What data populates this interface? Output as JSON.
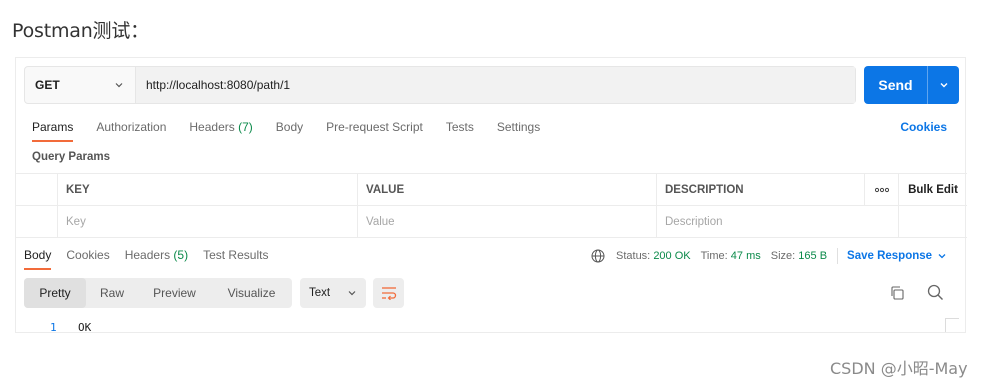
{
  "heading": "Postman测试：",
  "request": {
    "method": "GET",
    "url": "http://localhost:8080/path/1",
    "send_label": "Send"
  },
  "request_tabs": [
    {
      "label": "Params",
      "count": ""
    },
    {
      "label": "Authorization",
      "count": ""
    },
    {
      "label": "Headers",
      "count": "(7)"
    },
    {
      "label": "Body",
      "count": ""
    },
    {
      "label": "Pre-request Script",
      "count": ""
    },
    {
      "label": "Tests",
      "count": ""
    },
    {
      "label": "Settings",
      "count": ""
    }
  ],
  "cookies_link": "Cookies",
  "query_params": {
    "title": "Query Params",
    "columns": [
      "KEY",
      "VALUE",
      "DESCRIPTION"
    ],
    "more_label": "ooo",
    "bulk_edit": "Bulk Edit",
    "placeholders": [
      "Key",
      "Value",
      "Description"
    ]
  },
  "response_tabs": [
    {
      "label": "Body",
      "count": ""
    },
    {
      "label": "Cookies",
      "count": ""
    },
    {
      "label": "Headers",
      "count": "(5)"
    },
    {
      "label": "Test Results",
      "count": ""
    }
  ],
  "status": {
    "status_label": "Status:",
    "status_value": "200 OK",
    "time_label": "Time:",
    "time_value": "47 ms",
    "size_label": "Size:",
    "size_value": "165 B",
    "save_response": "Save Response"
  },
  "view_modes": [
    "Pretty",
    "Raw",
    "Preview",
    "Visualize"
  ],
  "format": "Text",
  "response_body": {
    "line_number": "1",
    "text": "OK"
  },
  "watermark": "CSDN @小昭-May",
  "colors": {
    "accent": "#0c76e6",
    "active_tab": "#f26b3a",
    "success": "#0b8a4a"
  }
}
